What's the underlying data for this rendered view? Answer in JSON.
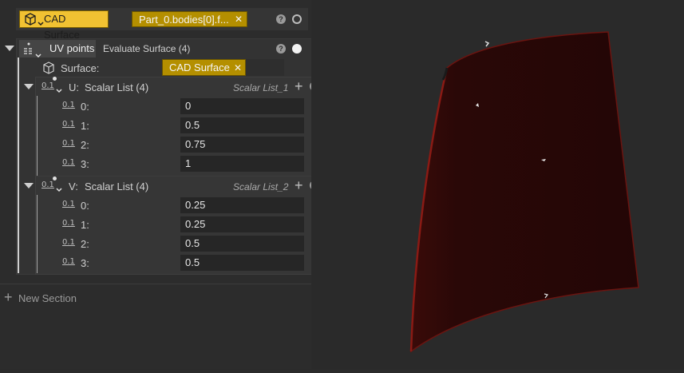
{
  "header": {
    "node_type_label": "CAD Surface",
    "source_value": "Part_0.bodies[0].f...",
    "clear_glyph": "✕",
    "help_glyph": "?"
  },
  "section": {
    "tab_label": "UV points",
    "operation_label": "Evaluate Surface (4)",
    "surface_label": "Surface:",
    "surface_value": "CAD Surface",
    "clear_glyph": "✕",
    "help_glyph": "?"
  },
  "u_list": {
    "axis_label": "U:",
    "title": "Scalar List (4)",
    "hint": "Scalar List_1",
    "index_icon_text": "0.1",
    "add_glyph": "+",
    "help_glyph": "?",
    "rows": [
      {
        "index": "0:",
        "value": "0"
      },
      {
        "index": "1:",
        "value": "0.5"
      },
      {
        "index": "2:",
        "value": "0.75"
      },
      {
        "index": "3:",
        "value": "1"
      }
    ]
  },
  "v_list": {
    "axis_label": "V:",
    "title": "Scalar List (4)",
    "hint": "Scalar List_2",
    "index_icon_text": "0.1",
    "add_glyph": "+",
    "help_glyph": "?",
    "rows": [
      {
        "index": "0:",
        "value": "0.25"
      },
      {
        "index": "1:",
        "value": "0.25"
      },
      {
        "index": "2:",
        "value": "0.5"
      },
      {
        "index": "3:",
        "value": "0.5"
      }
    ]
  },
  "footer": {
    "add_glyph": "+",
    "new_section_label": "New Section"
  },
  "viewport": {
    "surface_color": "#2a0807",
    "edge_color": "#6a1410",
    "accent_gold": "#b48f00"
  }
}
